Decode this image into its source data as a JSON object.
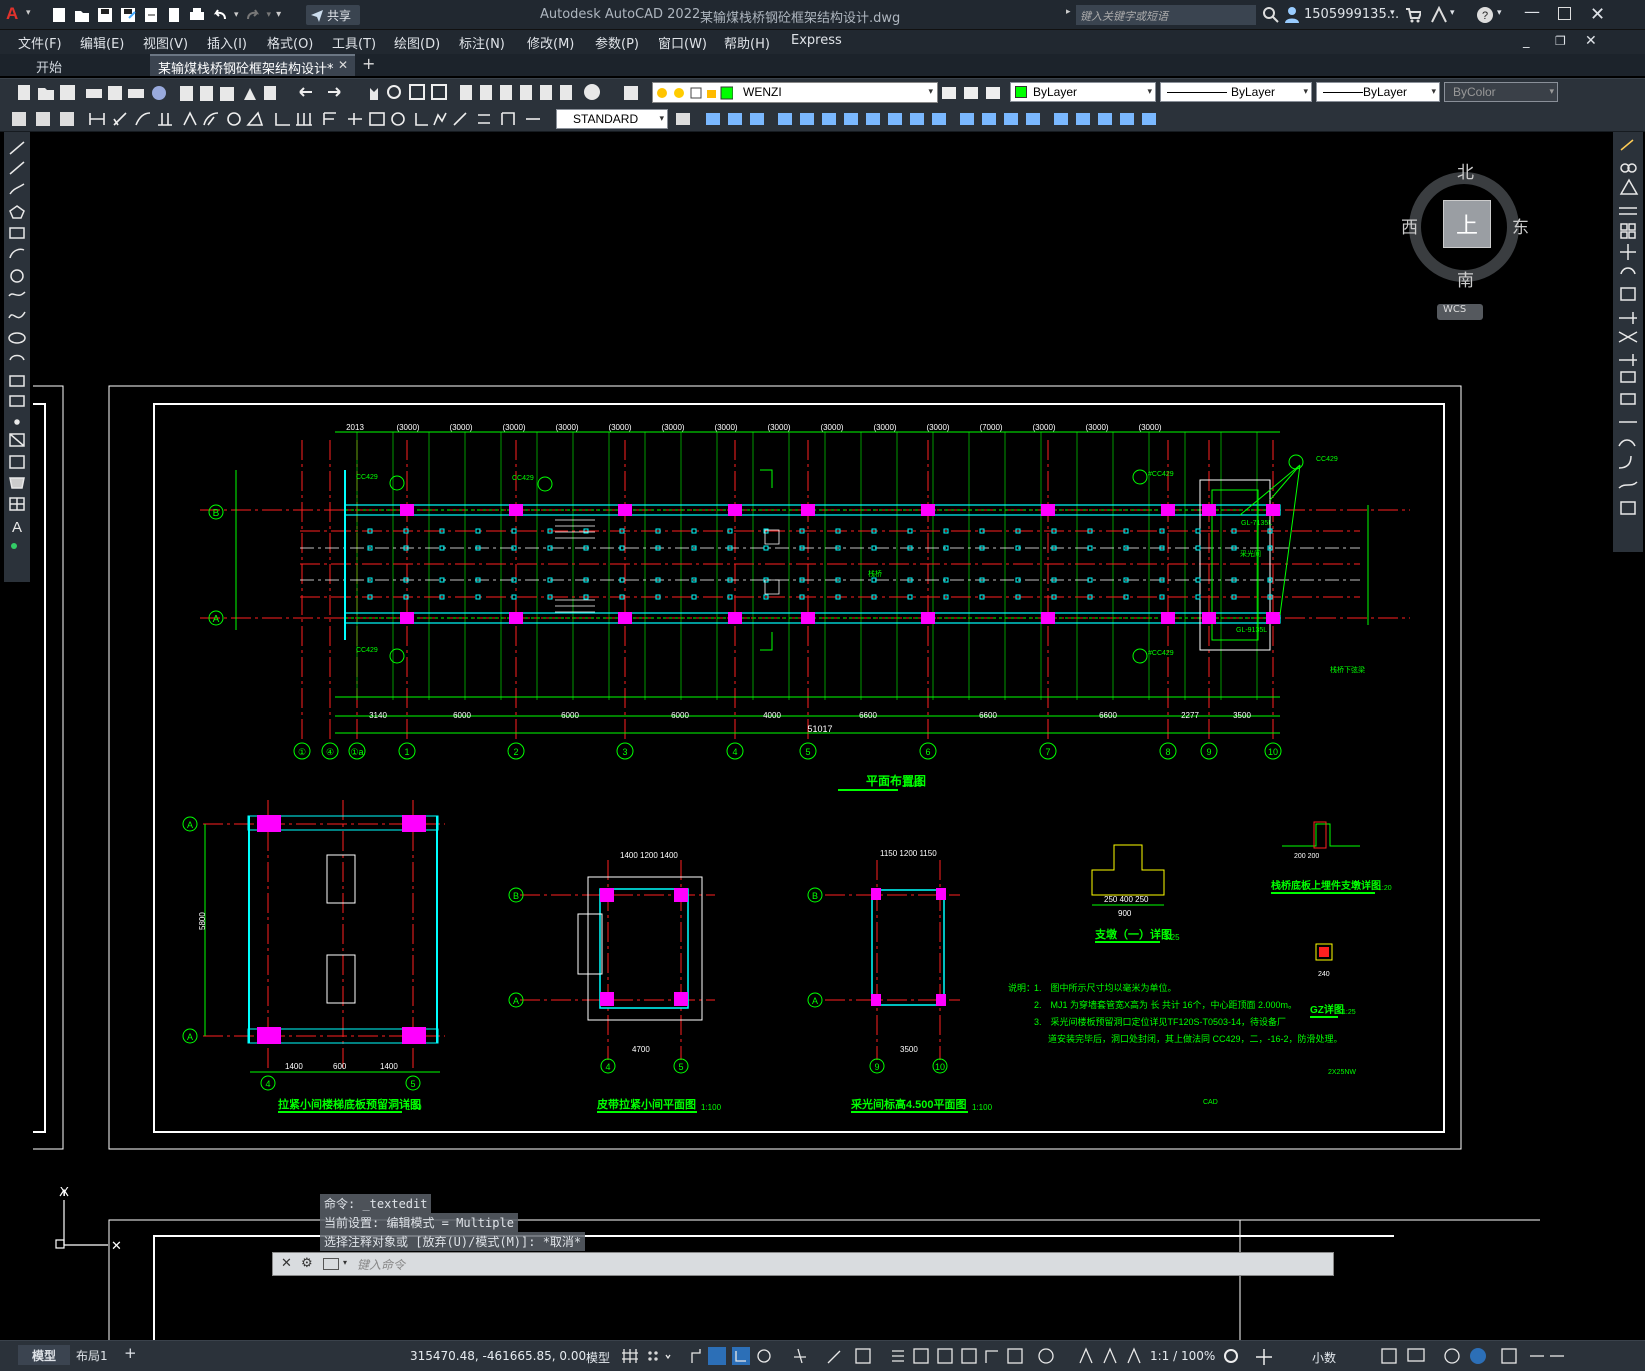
{
  "titlebar": {
    "app_title": "Autodesk AutoCAD 2022",
    "doc_title": "某输煤栈桥钢砼框架结构设计.dwg",
    "share_label": "共享",
    "search_placeholder": "键入关键字或短语",
    "user": "1505999135...",
    "logo_letter": "A"
  },
  "menu": [
    "文件(F)",
    "编辑(E)",
    "视图(V)",
    "插入(I)",
    "格式(O)",
    "工具(T)",
    "绘图(D)",
    "标注(N)",
    "修改(M)",
    "参数(P)",
    "窗口(W)",
    "帮助(H)",
    "Express"
  ],
  "tabs": {
    "start": "开始",
    "doc": "某输煤栈桥钢砼框架结构设计*",
    "add": "+"
  },
  "toolbar": {
    "layer": "WENZI",
    "color": "ByLayer",
    "linetype": "ByLayer",
    "lineweight": "ByLayer",
    "plotstyle": "ByColor",
    "textstyle": "STANDARD"
  },
  "viewcube": {
    "north": "北",
    "south": "南",
    "east": "东",
    "west": "西",
    "top": "上",
    "wcs": "WCS"
  },
  "drawing": {
    "plan_title": "平面布置图",
    "plan_scale": "1:100",
    "detail1_title": "拉紧小间楼梯底板预留洞详图",
    "detail1_scale": "1:50",
    "detail2_title": "皮带拉紧小间平面图",
    "detail2_scale": "1:100",
    "detail3_title": "采光间标高4.500平面图",
    "detail3_scale": "1:100",
    "support_title": "支墩（一）详图",
    "support_scale": "1:25",
    "bracket_title": "栈桥底板上埋件支墩详图",
    "bracket_scale": "1:20",
    "gz_title": "GZ详图",
    "gz_scale": "1:25",
    "notes_head": "说明：",
    "note1": "1.　图中所示尺寸均以毫米为单位。",
    "note2": "2.　MJ1 为穿墙套管宽X高为    长   共计 16个，中心距顶面 2.000m。",
    "note3": "3.　采光间楼板预留洞口定位详见TF120S-T0503-14，待设备厂",
    "note4": "道安装完毕后，洞口处封闭，其上做法同 CC429，二，-16-2，防滑处理。",
    "tag_cad": "CAD",
    "tag_2x": "2X25NW",
    "total_len": "51017",
    "axes_bottom": [
      "①",
      "④",
      "①a",
      "1",
      "2",
      "3",
      "4",
      "5",
      "6",
      "7",
      "8",
      "9",
      "10"
    ],
    "axis_left_top": "B",
    "axis_left_bot": "A",
    "dims_top": [
      "2013",
      "(3000)",
      "(3000)",
      "(3000)",
      "(3000)",
      "(3000)",
      "(3000)",
      "(3000)",
      "(3000)",
      "(3000)",
      "(3000)",
      "(3000)",
      "(7000)",
      "(3000)",
      "(3000)",
      "(3000)"
    ],
    "dims_row2": [
      "3140",
      "6000",
      "6000",
      "6000",
      "4000",
      "6600",
      "6600",
      "6600",
      "2277",
      "3500"
    ]
  },
  "command": {
    "line1": "命令: _textedit",
    "line2": "当前设置: 编辑模式 = Multiple",
    "line3": "选择注释对象或 [放弃(U)/模式(M)]: *取消*",
    "input_placeholder": "键入命令"
  },
  "status": {
    "model_tab": "模型",
    "layout_tab": "布局1",
    "coords": "315470.48, -461665.85, 0.00",
    "model_btn": "模型",
    "scale": "1:1 / 100%",
    "units": "小数"
  },
  "colors": {
    "accent": "#00ff00",
    "magenta": "#ff00ff",
    "red_axis": "#ff2020",
    "cyan": "#00ffff",
    "canvas": "#000000"
  }
}
